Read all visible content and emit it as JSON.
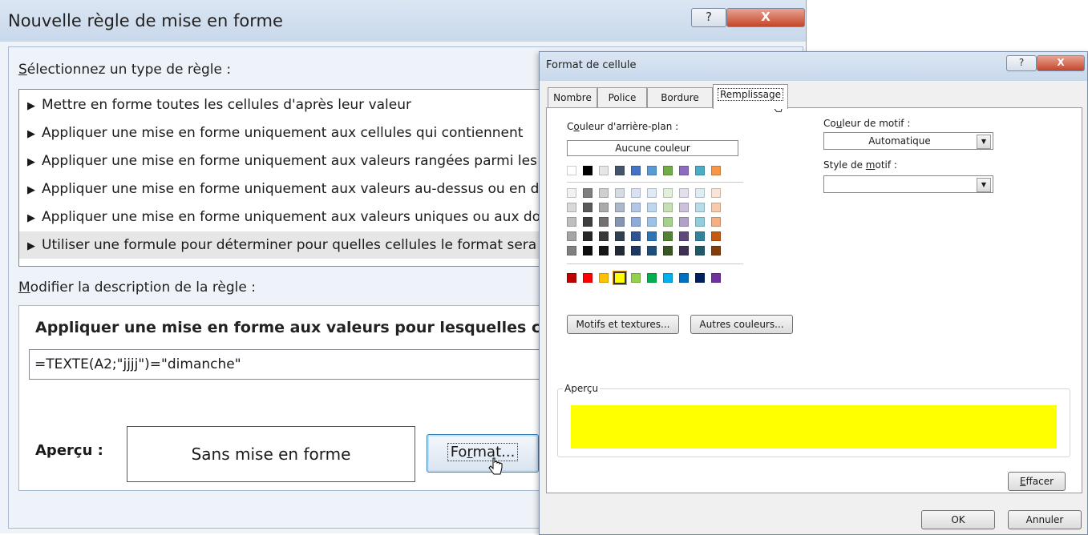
{
  "rule_dialog": {
    "title": "Nouvelle règle de mise en forme",
    "help_glyph": "?",
    "close_glyph": "X",
    "select_type_label_u": "S",
    "select_type_label_rest": "électionnez un type de règle :",
    "rules": [
      "Mettre en forme toutes les cellules d'après leur valeur",
      "Appliquer une mise en forme uniquement aux cellules qui contiennent",
      "Appliquer une mise en forme uniquement aux valeurs rangées parmi les premières ou les dernières valeurs",
      "Appliquer une mise en forme uniquement aux valeurs au-dessus ou en dessous de la moyenne",
      "Appliquer une mise en forme uniquement aux valeurs uniques ou aux doublons",
      "Utiliser une formule pour déterminer pour quelles cellules le format sera appliqué"
    ],
    "selected_rule_index": 5,
    "edit_desc_label_u": "M",
    "edit_desc_label_rest": "odifier la description de la règle :",
    "formula_heading": "Appliquer une mise en forme aux valeurs pour lesquelles cette formule est vraie :",
    "formula_value": "=TEXTE(A2;\"jjjj\")=\"dimanche\"",
    "preview_label": "Aperçu :",
    "preview_text": "Sans mise en forme",
    "format_button_pre": "Fo",
    "format_button_u": "r",
    "format_button_post": "mat..."
  },
  "cell_format_dialog": {
    "title": "Format de cellule",
    "help_glyph": "?",
    "close_glyph": "X",
    "tabs": [
      "Nombre",
      "Police",
      "Bordure",
      "Remplissage"
    ],
    "active_tab": "Remplissage",
    "bg_color_label_pre": "C",
    "bg_color_label_u": "o",
    "bg_color_label_post": "uleur d'arrière-plan :",
    "no_color_button": "Aucune couleur",
    "pattern_color_label_pre": "Co",
    "pattern_color_label_u": "u",
    "pattern_color_label_post": "leur de motif :",
    "pattern_color_value": "Automatique",
    "pattern_style_label_pre": "Style de ",
    "pattern_style_label_u": "m",
    "pattern_style_label_post": "otif :",
    "pattern_style_value": "",
    "textures_button": "Motifs et textures...",
    "more_colors_button": "Autres couleurs...",
    "preview_legend": "Aperçu",
    "preview_color": "#ffff00",
    "clear_button": "Effacer",
    "ok_button": "OK",
    "cancel_button": "Annuler",
    "palette": {
      "theme_top": [
        "#ffffff",
        "#000000",
        "#e7e6e6",
        "#44546a",
        "#4472c4",
        "#5b9bd5",
        "#70ad47",
        "#8e6bbf",
        "#4bacc6",
        "#f79646"
      ],
      "tints": [
        [
          "#f2f2f2",
          "#7f7f7f",
          "#d0cece",
          "#d6dce4",
          "#d9e2f3",
          "#deeaf6",
          "#e2efd9",
          "#e4dfec",
          "#deeef3",
          "#fbe4d5"
        ],
        [
          "#d9d9d9",
          "#595959",
          "#aeaaaa",
          "#adb9ca",
          "#b4c6e7",
          "#bdd7ee",
          "#c5e0b3",
          "#ccc0da",
          "#b6dde8",
          "#f7caac"
        ],
        [
          "#bfbfbf",
          "#3f3f3f",
          "#757070",
          "#8496b0",
          "#8eaadb",
          "#9cc3e5",
          "#a8d08d",
          "#b2a1c7",
          "#92cddc",
          "#f4b083"
        ],
        [
          "#a5a5a5",
          "#262626",
          "#3a3838",
          "#323f4f",
          "#2f5496",
          "#2e75b5",
          "#538135",
          "#5f497a",
          "#31849b",
          "#c45911"
        ],
        [
          "#7f7f7f",
          "#0d0d0d",
          "#171616",
          "#222a35",
          "#1f3763",
          "#1e4e79",
          "#375623",
          "#3f3151",
          "#205867",
          "#833c0b"
        ]
      ],
      "standard": [
        "#c00000",
        "#ff0000",
        "#ffc000",
        "#ffff00",
        "#92d050",
        "#00b050",
        "#00b0f0",
        "#0070c0",
        "#002060",
        "#7030a0"
      ],
      "selected_standard_index": 3
    }
  }
}
